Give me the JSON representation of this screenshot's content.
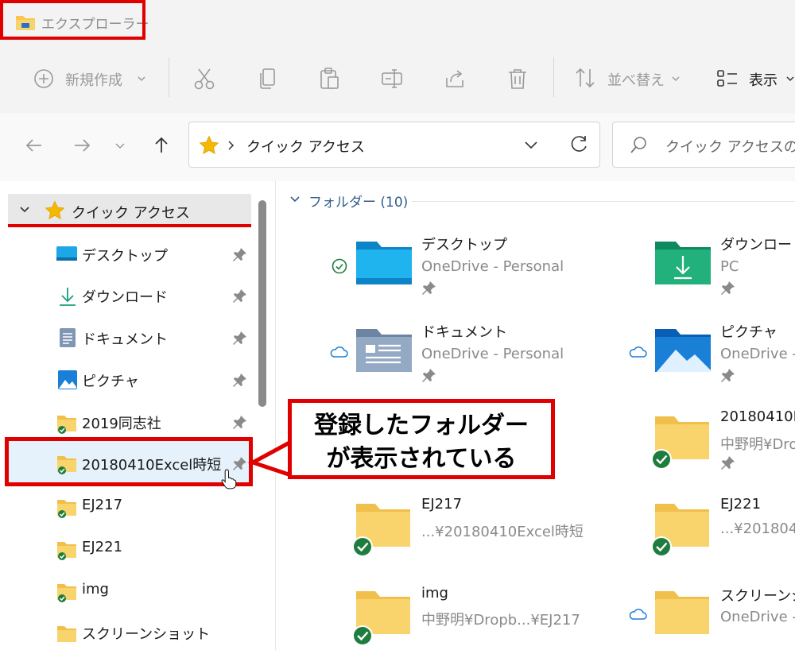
{
  "window": {
    "title": "エクスプローラー"
  },
  "toolbar": {
    "new_label": "新規作成",
    "sort_label": "並べ替え",
    "view_label": "表示"
  },
  "address": {
    "location": "クイック アクセス",
    "search_placeholder": "クイック アクセスの検"
  },
  "sidebar": {
    "quick_access_label": "クイック アクセス",
    "items": [
      {
        "label": "デスクトップ",
        "icon": "desktop-icon",
        "pinned": true
      },
      {
        "label": "ダウンロード",
        "icon": "download-icon",
        "pinned": true
      },
      {
        "label": "ドキュメント",
        "icon": "document-icon",
        "pinned": true
      },
      {
        "label": "ピクチャ",
        "icon": "picture-icon",
        "pinned": true
      },
      {
        "label": "2019同志社",
        "icon": "folder-icon",
        "pinned": true
      },
      {
        "label": "20180410Excel時短",
        "icon": "folder-icon",
        "pinned": true
      },
      {
        "label": "EJ217",
        "icon": "folder-icon",
        "pinned": false
      },
      {
        "label": "EJ221",
        "icon": "folder-icon",
        "pinned": false
      },
      {
        "label": "img",
        "icon": "folder-icon",
        "pinned": false
      },
      {
        "label": "スクリーンショット",
        "icon": "folder-icon",
        "pinned": false
      }
    ]
  },
  "main": {
    "group_header": "フォルダー (10)",
    "tiles": [
      {
        "name": "デスクトップ",
        "sub": "OneDrive - Personal"
      },
      {
        "name": "ダウンロード",
        "sub": "PC"
      },
      {
        "name": "ドキュメント",
        "sub": "OneDrive - Personal"
      },
      {
        "name": "ピクチャ",
        "sub": "OneDrive -"
      },
      {
        "name": "20180410E",
        "sub": "中野明¥Dro"
      },
      {
        "name": "EJ217",
        "sub": "...¥20180410Excel時短"
      },
      {
        "name": "EJ221",
        "sub": "...¥201804"
      },
      {
        "name": "img",
        "sub": "中野明¥Dropb...¥EJ217"
      },
      {
        "name": "スクリーンショ",
        "sub": "OneDrive -"
      }
    ]
  },
  "callout": {
    "line1": "登録したフォルダー",
    "line2": "が表示されている"
  },
  "colors": {
    "highlight": "#e00000",
    "folder": "#f9d36b",
    "synced_green": "#1e7d3e",
    "accent": "#0078d4"
  }
}
